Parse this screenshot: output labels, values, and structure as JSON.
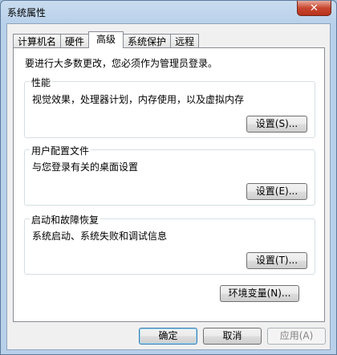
{
  "window": {
    "title": "系统属性",
    "close_glyph": "✕"
  },
  "tabs": [
    {
      "label": "计算机名"
    },
    {
      "label": "硬件"
    },
    {
      "label": "高级"
    },
    {
      "label": "系统保护"
    },
    {
      "label": "远程"
    }
  ],
  "active_tab": "高级",
  "intro_text": "要进行大多数更改，您必须作为管理员登录。",
  "performance": {
    "title": "性能",
    "description": "视觉效果，处理器计划，内存使用，以及虚拟内存",
    "button": "设置(S)..."
  },
  "user_profiles": {
    "title": "用户配置文件",
    "description": "与您登录有关的桌面设置",
    "button": "设置(E)..."
  },
  "startup_recovery": {
    "title": "启动和故障恢复",
    "description": "系统启动、系统失败和调试信息",
    "button": "设置(T)..."
  },
  "env_button": "环境变量(N)...",
  "footer": {
    "ok": "确定",
    "cancel": "取消",
    "apply": "应用(A)"
  }
}
